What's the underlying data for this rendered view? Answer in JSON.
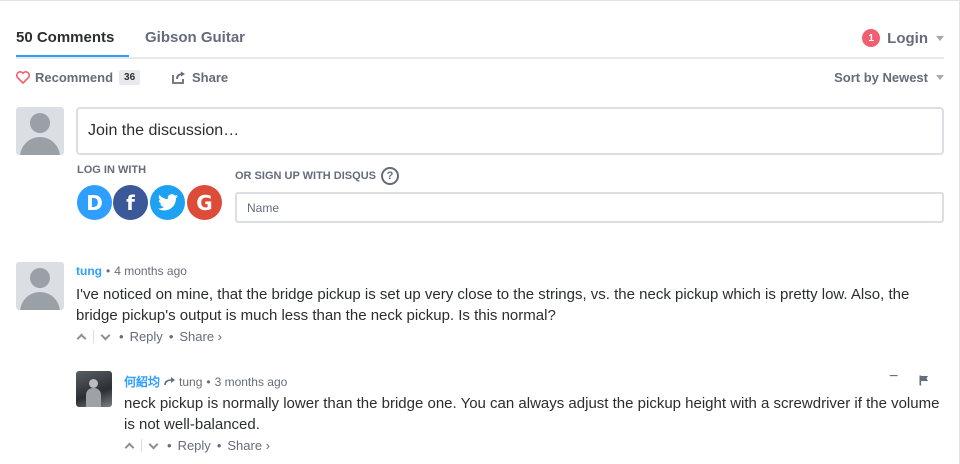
{
  "nav": {
    "comments_tab": "50 Comments",
    "site_tab": "Gibson Guitar",
    "notification_count": "1",
    "login_label": "Login"
  },
  "toolbar": {
    "recommend_label": "Recommend",
    "recommend_count": "36",
    "share_label": "Share",
    "sort_label": "Sort by Newest"
  },
  "compose": {
    "placeholder": "Join the discussion…",
    "login_with": "LOG IN WITH",
    "or_signup": "OR SIGN UP WITH DISQUS",
    "help_symbol": "?",
    "name_placeholder": "Name",
    "social": [
      {
        "letter": "D",
        "service": "disqus",
        "color": "#2e9fff"
      },
      {
        "letter": "f",
        "service": "facebook",
        "color": "#3b5998"
      },
      {
        "letter": "t",
        "service": "twitter",
        "color": "#1da1f2"
      },
      {
        "letter": "G",
        "service": "google",
        "color": "#dd4b39"
      }
    ]
  },
  "comments": [
    {
      "author": "tung",
      "time": "4 months ago",
      "text": "I've noticed on mine, that the bridge pickup is set up very close to the strings, vs. the neck pickup which is pretty low. Also, the bridge pickup's output is much less than the neck pickup. Is this normal?",
      "reply_label": "Reply",
      "share_label": "Share ›"
    },
    {
      "author": "何紹均",
      "reply_to": "tung",
      "time": "3 months ago",
      "text": "neck pickup is normally lower than the bridge one. You can always adjust the pickup height with a screwdriver if the volume is not well-balanced.",
      "reply_label": "Reply",
      "share_label": "Share ›",
      "collapse_symbol": "−"
    }
  ],
  "separator": "•"
}
